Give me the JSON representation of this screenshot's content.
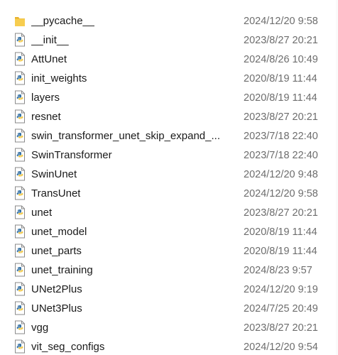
{
  "files": [
    {
      "name": "__pycache__",
      "date": "2024/12/20 9:58",
      "icon": "folder-icon"
    },
    {
      "name": "__init__",
      "date": "2023/8/27 20:21",
      "icon": "python-file-icon"
    },
    {
      "name": "AttUnet",
      "date": "2024/8/26 10:49",
      "icon": "python-file-icon"
    },
    {
      "name": "init_weights",
      "date": "2020/8/19 11:44",
      "icon": "python-file-icon"
    },
    {
      "name": "layers",
      "date": "2020/8/19 11:44",
      "icon": "python-file-icon"
    },
    {
      "name": "resnet",
      "date": "2023/8/27 20:21",
      "icon": "python-file-icon"
    },
    {
      "name": "swin_transformer_unet_skip_expand_...",
      "date": "2023/7/18 22:40",
      "icon": "python-file-icon"
    },
    {
      "name": "SwinTransformer",
      "date": "2023/7/18 22:40",
      "icon": "python-file-icon"
    },
    {
      "name": "SwinUnet",
      "date": "2024/12/20 9:48",
      "icon": "python-file-icon"
    },
    {
      "name": "TransUnet",
      "date": "2024/12/20 9:58",
      "icon": "python-file-icon"
    },
    {
      "name": "unet",
      "date": "2023/8/27 20:21",
      "icon": "python-file-icon"
    },
    {
      "name": "unet_model",
      "date": "2020/8/19 11:44",
      "icon": "python-file-icon"
    },
    {
      "name": "unet_parts",
      "date": "2020/8/19 11:44",
      "icon": "python-file-icon"
    },
    {
      "name": "unet_training",
      "date": "2024/8/23 9:57",
      "icon": "python-file-icon"
    },
    {
      "name": "UNet2Plus",
      "date": "2024/12/20 9:19",
      "icon": "python-file-icon"
    },
    {
      "name": "UNet3Plus",
      "date": "2024/7/25 20:49",
      "icon": "python-file-icon"
    },
    {
      "name": "vgg",
      "date": "2023/8/27 20:21",
      "icon": "python-file-icon"
    },
    {
      "name": "vit_seg_configs",
      "date": "2024/12/20 9:54",
      "icon": "python-file-icon"
    }
  ],
  "colors": {
    "folder": "#f5c542",
    "python_blue": "#3572a5",
    "python_yellow": "#f3c843",
    "date_text": "#6d6d6d"
  }
}
